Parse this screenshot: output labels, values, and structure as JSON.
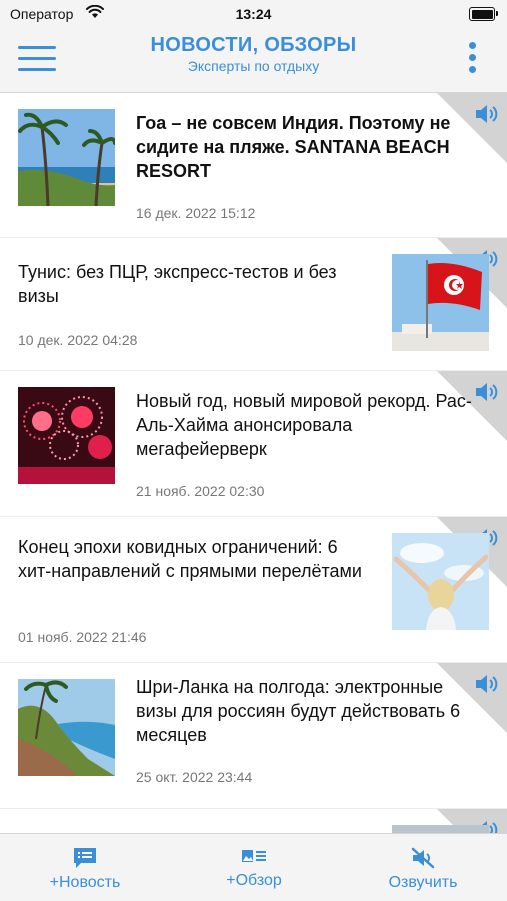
{
  "status": {
    "carrier": "Оператор",
    "time": "13:24"
  },
  "header": {
    "title": "НОВОСТИ, ОБЗОРЫ",
    "subtitle": "Эксперты по отдыху"
  },
  "feed": [
    {
      "title": "Гоа – не совсем Индия. Поэтому не сидите на пляже. SANTANA BEACH RESORT",
      "date": "16 дек. 2022 15:12"
    },
    {
      "title": "Тунис: без ПЦР, экспресс-тестов и без визы",
      "date": "10 дек. 2022 04:28"
    },
    {
      "title": "Новый год, новый мировой рекорд. Рас-Аль-Хайма анонсировала мегафейерверк",
      "date": "21 нояб. 2022 02:30"
    },
    {
      "title": "Конец эпохи ковидных ограничений: 6 хит-направлений с прямыми перелётами",
      "date": "01 нояб. 2022 21:46"
    },
    {
      "title": "Шри-Ланка на полгода: электронные визы для россиян будут действовать 6 месяцев",
      "date": "25 окт. 2022 23:44"
    }
  ],
  "tabbar": {
    "news": "+Новость",
    "review": "+Обзор",
    "voice": "Озвучить"
  },
  "colors": {
    "accent": "#3a8fd8",
    "corner": "#d3d3d3"
  }
}
